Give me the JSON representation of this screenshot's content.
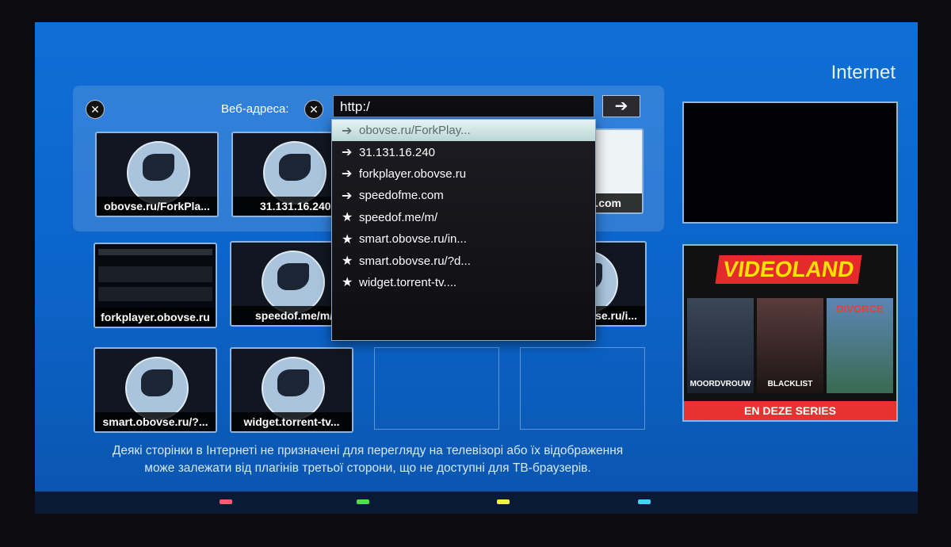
{
  "header": {
    "title": "Internet"
  },
  "address_bar": {
    "label": "Веб-адреса:",
    "value": "http:/",
    "clear_icon": "close-icon",
    "go_icon": "arrow-right-icon"
  },
  "dropdown": {
    "items": [
      {
        "icon": "➔",
        "label": "obovse.ru/ForkPlay...",
        "highlighted": true
      },
      {
        "icon": "➔",
        "label": "31.131.16.240"
      },
      {
        "icon": "➔",
        "label": "forkplayer.obovse.ru"
      },
      {
        "icon": "➔",
        "label": "speedofme.com"
      },
      {
        "icon": "★",
        "label": "speedof.me/m/"
      },
      {
        "icon": "★",
        "label": "smart.obovse.ru/in..."
      },
      {
        "icon": "★",
        "label": "smart.obovse.ru/?d..."
      },
      {
        "icon": "★",
        "label": "widget.torrent-tv...."
      }
    ]
  },
  "tiles": [
    {
      "label": "obovse.ru/ForkPla..."
    },
    {
      "label": "31.131.16.240"
    },
    {
      "label": ".com"
    },
    {
      "label": "forkplayer.obovse.ru"
    },
    {
      "label": "speedof.me/m/"
    },
    {
      "label": "rse.ru/i..."
    },
    {
      "label": "smart.obovse.ru/?..."
    },
    {
      "label": "widget.torrent-tv..."
    }
  ],
  "promo": {
    "logo": "VIDEOLAND",
    "posters": [
      "MOORDVROUW",
      "BLACKLIST",
      "DIVORCE"
    ],
    "banner": "EN DEZE SERIES"
  },
  "footer_note": {
    "line1": "Деякі сторінки в Інтернеті не призначені для перегляду на телевізорі або їх відображення",
    "line2": "може залежати від плагінів третьої сторони, що не доступні для ТВ-браузерів."
  },
  "color_keys": [
    "#ff5a6e",
    "#4ee04a",
    "#f2f23a",
    "#3ad6f2"
  ]
}
